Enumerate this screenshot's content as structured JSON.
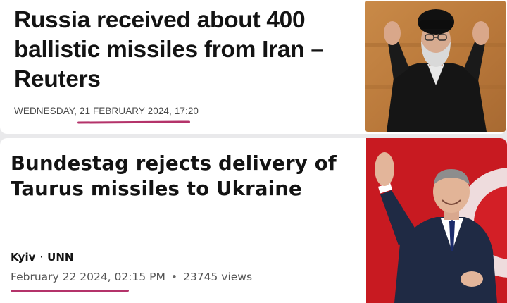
{
  "articles": [
    {
      "headline": "Russia received about 400 ballistic missiles from Iran – Reuters",
      "dateline": "WEDNESDAY, 21 FEBRUARY 2024, 17:20",
      "accent_color": "#b4336a"
    },
    {
      "headline": "Bundestag rejects delivery of Taurus missiles to Ukraine",
      "location": "Kyiv",
      "source": "UNN",
      "date": "February 22 2024, 02:15 PM",
      "views": "23745 views",
      "accent_color": "#b4336a"
    }
  ]
}
